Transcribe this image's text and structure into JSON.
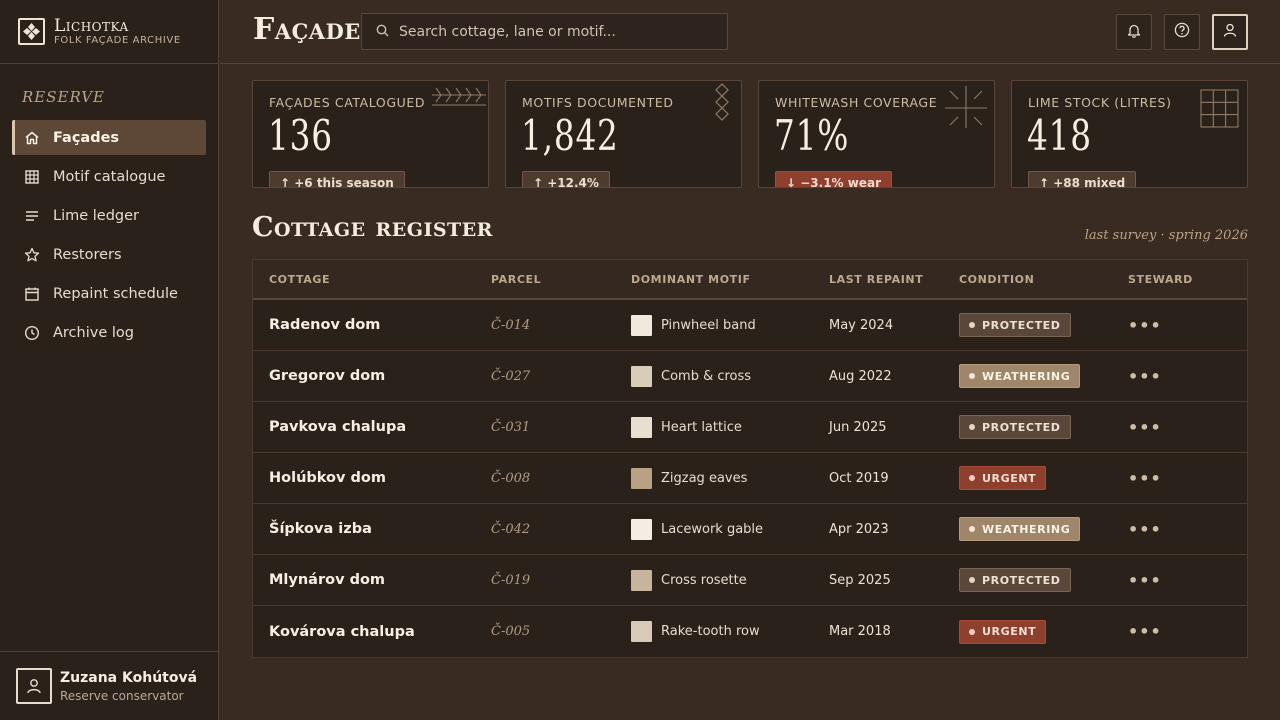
{
  "app": {
    "name": "Lichotka",
    "subtitle": "FOLK FAÇADE ARCHIVE"
  },
  "sidebar": {
    "section_label": "RESERVE",
    "items": [
      {
        "label": "Façades",
        "icon": "home-icon",
        "active": true
      },
      {
        "label": "Motif catalogue",
        "icon": "grid-icon",
        "active": false
      },
      {
        "label": "Lime ledger",
        "icon": "lines-icon",
        "active": false
      },
      {
        "label": "Restorers",
        "icon": "star-icon",
        "active": false
      },
      {
        "label": "Repaint schedule",
        "icon": "calendar-icon",
        "active": false
      },
      {
        "label": "Archive log",
        "icon": "clock-icon",
        "active": false
      }
    ]
  },
  "user": {
    "name": "Zuzana Kohútová",
    "role": "Reserve conservator"
  },
  "header": {
    "title": "Façades",
    "search_placeholder": "Search cottage, lane or motif..."
  },
  "stats": [
    {
      "label": "FAÇADES CATALOGUED",
      "value": "136",
      "badge": "↑ +6 this season",
      "trend": "positive"
    },
    {
      "label": "MOTIFS DOCUMENTED",
      "value": "1,842",
      "badge": "↑ +12.4%",
      "trend": "positive"
    },
    {
      "label": "WHITEWASH COVERAGE",
      "value": "71%",
      "badge": "↓ −3.1% wear",
      "trend": "negative"
    },
    {
      "label": "LIME STOCK (LITRES)",
      "value": "418",
      "badge": "↑ +88 mixed",
      "trend": "positive"
    }
  ],
  "register": {
    "title": "Cottage register",
    "note": "last survey · spring 2026",
    "columns": [
      "COTTAGE",
      "PARCEL",
      "DOMINANT MOTIF",
      "LAST REPAINT",
      "CONDITION",
      "STEWARD"
    ],
    "more_glyph": "•••",
    "rows": [
      {
        "cottage": "Radenov dom",
        "parcel": "Č-014",
        "motif": "Pinwheel band",
        "swatch": "#f1e9dc",
        "repaint": "May 2024",
        "condition": "PROTECTED",
        "status": "protected"
      },
      {
        "cottage": "Gregorov dom",
        "parcel": "Č-027",
        "motif": "Comb & cross",
        "swatch": "#d9ccb8",
        "repaint": "Aug 2022",
        "condition": "WEATHERING",
        "status": "weathering"
      },
      {
        "cottage": "Pavkova chalupa",
        "parcel": "Č-031",
        "motif": "Heart lattice",
        "swatch": "#e8dfcf",
        "repaint": "Jun 2025",
        "condition": "PROTECTED",
        "status": "protected"
      },
      {
        "cottage": "Holúbkov dom",
        "parcel": "Č-008",
        "motif": "Zigzag eaves",
        "swatch": "#b9a183",
        "repaint": "Oct 2019",
        "condition": "URGENT",
        "status": "urgent"
      },
      {
        "cottage": "Šípkova izba",
        "parcel": "Č-042",
        "motif": "Lacework gable",
        "swatch": "#f3ede3",
        "repaint": "Apr 2023",
        "condition": "WEATHERING",
        "status": "weathering"
      },
      {
        "cottage": "Mlynárov dom",
        "parcel": "Č-019",
        "motif": "Cross rosette",
        "swatch": "#c6b59c",
        "repaint": "Sep 2025",
        "condition": "PROTECTED",
        "status": "protected"
      },
      {
        "cottage": "Kovárova chalupa",
        "parcel": "Č-005",
        "motif": "Rake-tooth row",
        "swatch": "#d8cab6",
        "repaint": "Mar 2018",
        "condition": "URGENT",
        "status": "urgent"
      }
    ]
  }
}
